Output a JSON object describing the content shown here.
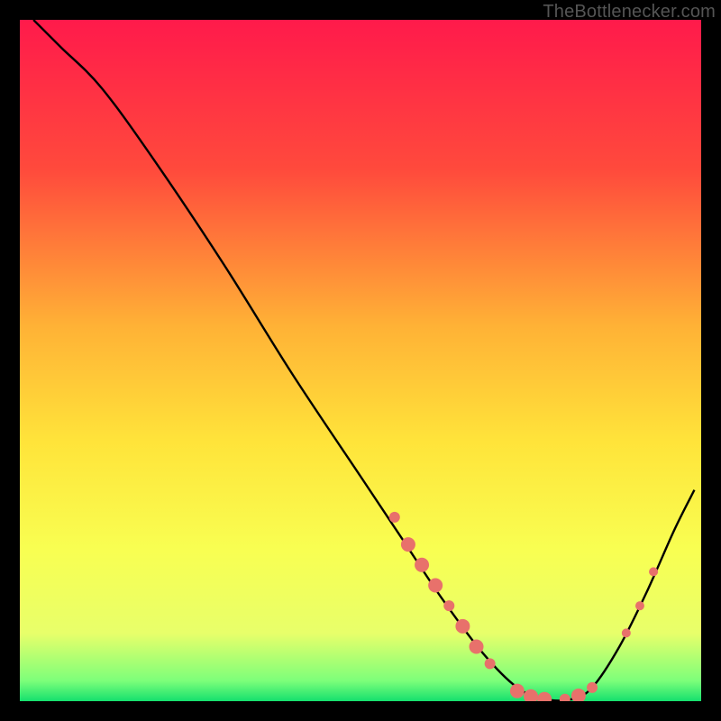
{
  "attribution": "TheBottlenecker.com",
  "chart_data": {
    "type": "line",
    "title": "",
    "xlabel": "",
    "ylabel": "",
    "xlim": [
      0,
      100
    ],
    "ylim": [
      0,
      100
    ],
    "gradient_stops": [
      {
        "offset": 0,
        "color": "#ff1a4b"
      },
      {
        "offset": 22,
        "color": "#ff4a3c"
      },
      {
        "offset": 45,
        "color": "#ffb236"
      },
      {
        "offset": 62,
        "color": "#ffe43a"
      },
      {
        "offset": 78,
        "color": "#f8ff52"
      },
      {
        "offset": 90,
        "color": "#e8ff6a"
      },
      {
        "offset": 97,
        "color": "#7dff7a"
      },
      {
        "offset": 100,
        "color": "#15e06e"
      }
    ],
    "series": [
      {
        "name": "curve",
        "points": [
          {
            "x": 2,
            "y": 100
          },
          {
            "x": 6,
            "y": 96
          },
          {
            "x": 12,
            "y": 90
          },
          {
            "x": 20,
            "y": 79
          },
          {
            "x": 30,
            "y": 64
          },
          {
            "x": 40,
            "y": 48
          },
          {
            "x": 50,
            "y": 33
          },
          {
            "x": 56,
            "y": 24
          },
          {
            "x": 62,
            "y": 15
          },
          {
            "x": 68,
            "y": 7
          },
          {
            "x": 73,
            "y": 2
          },
          {
            "x": 77,
            "y": 0.3
          },
          {
            "x": 81,
            "y": 0.3
          },
          {
            "x": 84,
            "y": 2
          },
          {
            "x": 88,
            "y": 8
          },
          {
            "x": 92,
            "y": 16
          },
          {
            "x": 96,
            "y": 25
          },
          {
            "x": 99,
            "y": 31
          }
        ]
      }
    ],
    "markers": [
      {
        "x": 55,
        "y": 27,
        "r": 6
      },
      {
        "x": 57,
        "y": 23,
        "r": 8
      },
      {
        "x": 59,
        "y": 20,
        "r": 8
      },
      {
        "x": 61,
        "y": 17,
        "r": 8
      },
      {
        "x": 63,
        "y": 14,
        "r": 6
      },
      {
        "x": 65,
        "y": 11,
        "r": 8
      },
      {
        "x": 67,
        "y": 8,
        "r": 8
      },
      {
        "x": 69,
        "y": 5.5,
        "r": 6
      },
      {
        "x": 73,
        "y": 1.5,
        "r": 8
      },
      {
        "x": 75,
        "y": 0.7,
        "r": 8
      },
      {
        "x": 77,
        "y": 0.3,
        "r": 8
      },
      {
        "x": 80,
        "y": 0.3,
        "r": 6
      },
      {
        "x": 82,
        "y": 0.8,
        "r": 8
      },
      {
        "x": 84,
        "y": 2,
        "r": 6
      },
      {
        "x": 89,
        "y": 10,
        "r": 5
      },
      {
        "x": 91,
        "y": 14,
        "r": 5
      },
      {
        "x": 93,
        "y": 19,
        "r": 5
      }
    ],
    "marker_color": "#e8716b"
  }
}
